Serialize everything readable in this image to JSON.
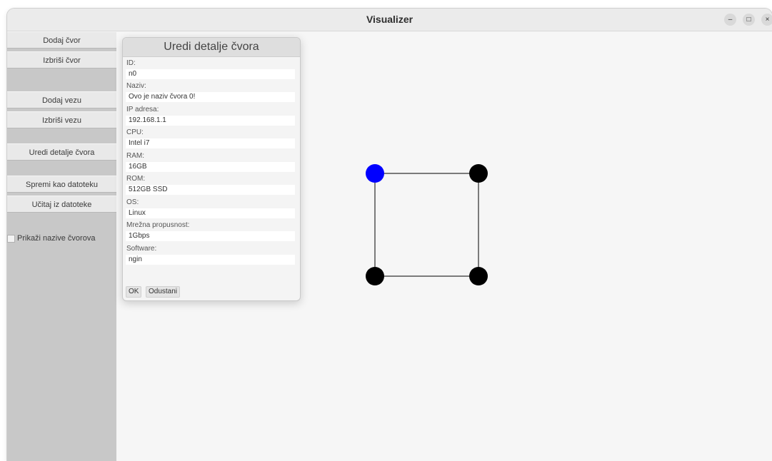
{
  "window": {
    "title": "Visualizer",
    "controls": {
      "minimize": "–",
      "maximize": "□",
      "close": "×"
    }
  },
  "sidebar": {
    "buttons": [
      {
        "label": "Dodaj čvor"
      },
      {
        "label": "Izbriši čvor"
      },
      {
        "label": "Dodaj vezu"
      },
      {
        "label": "Izbriši vezu"
      },
      {
        "label": "Uredi detalje čvora"
      },
      {
        "label": "Spremi kao datoteku"
      },
      {
        "label": "Učitaj iz datoteke"
      }
    ],
    "show_names": {
      "label": "Prikaži nazive čvorova",
      "checked": false
    }
  },
  "dialog": {
    "title": "Uredi detalje čvora",
    "fields": [
      {
        "label": "ID:",
        "value": "n0"
      },
      {
        "label": "Naziv:",
        "value": "Ovo je naziv čvora 0!"
      },
      {
        "label": "IP adresa:",
        "value": "192.168.1.1"
      },
      {
        "label": "CPU:",
        "value": "Intel i7"
      },
      {
        "label": "RAM:",
        "value": "16GB"
      },
      {
        "label": "ROM:",
        "value": "512GB SSD"
      },
      {
        "label": "OS:",
        "value": "Linux"
      },
      {
        "label": "Mrežna propusnost:",
        "value": "1Gbps"
      },
      {
        "label": "Software:",
        "value": "ngin"
      }
    ],
    "ok_label": "OK",
    "cancel_label": "Odustani"
  },
  "graph": {
    "colors": {
      "selected": "#0000ff",
      "node": "#000000",
      "edge": "#000000"
    },
    "nodes": [
      {
        "selected": true
      },
      {
        "selected": false
      },
      {
        "selected": false
      },
      {
        "selected": false
      }
    ]
  }
}
